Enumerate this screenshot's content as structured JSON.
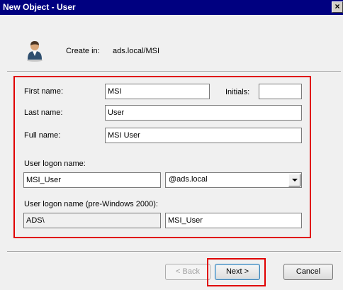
{
  "window": {
    "title": "New Object - User",
    "close_label": "×"
  },
  "header": {
    "create_in_label": "Create in:",
    "create_in_value": "ads.local/MSI"
  },
  "form": {
    "first_name_label": "First name:",
    "first_name_value": "MSI",
    "initials_label": "Initials:",
    "initials_value": "",
    "last_name_label": "Last name:",
    "last_name_value": "User",
    "full_name_label": "Full name:",
    "full_name_value": "MSI User",
    "logon_name_label": "User logon name:",
    "logon_name_value": "MSI_User",
    "domain_selected": "@ads.local",
    "pre2000_label": "User logon name (pre-Windows 2000):",
    "pre2000_domain": "ADS\\",
    "pre2000_value": "MSI_User"
  },
  "buttons": {
    "back_label": "< Back",
    "next_label": "Next >",
    "cancel_label": "Cancel"
  },
  "colors": {
    "highlight": "#e00000",
    "titlebar": "#000080"
  }
}
